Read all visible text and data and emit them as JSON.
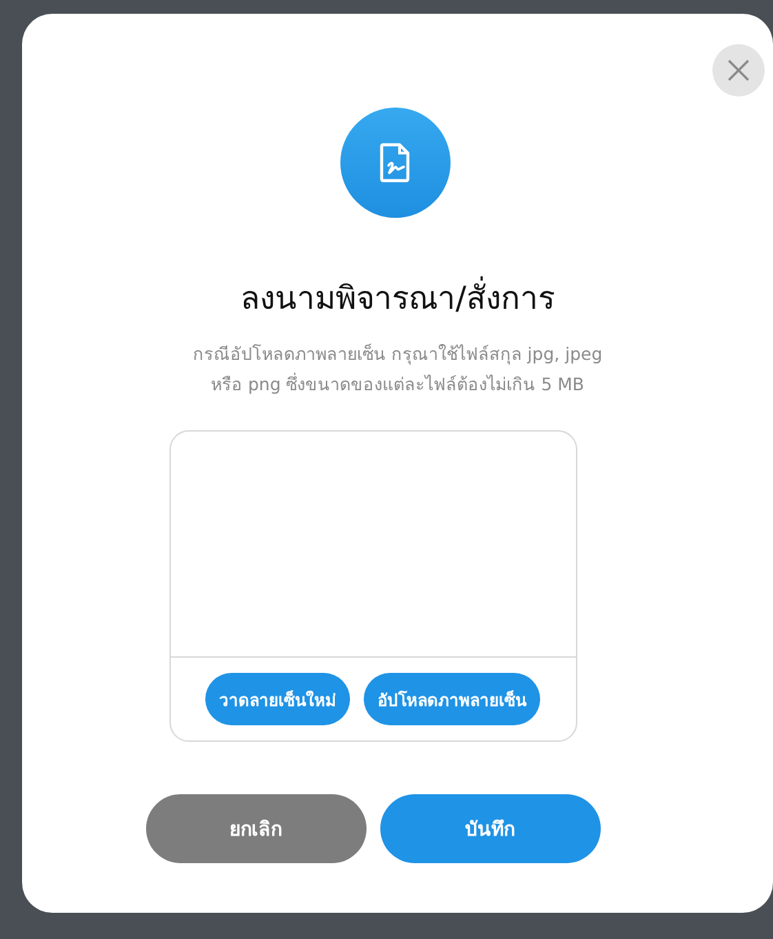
{
  "dialog": {
    "title": "ลงนามพิจารณา/สั่งการ",
    "description_lines": [
      "กรณีอัปโหลดภาพลายเซ็น กรุณาใช้ไฟล์สกุล jpg, jpeg",
      "หรือ png ซึ่งขนาดของแต่ละไฟล์ต้องไม่เกิน 5 MB"
    ],
    "pad_buttons": [
      {
        "label": "วาดลายเซ็นใหม่"
      },
      {
        "label": "อัปโหลดภาพลายเซ็น"
      }
    ],
    "footer_buttons": [
      {
        "label": "ยกเลิก",
        "kind": "secondary"
      },
      {
        "label": "บันทึก",
        "kind": "primary"
      }
    ]
  }
}
